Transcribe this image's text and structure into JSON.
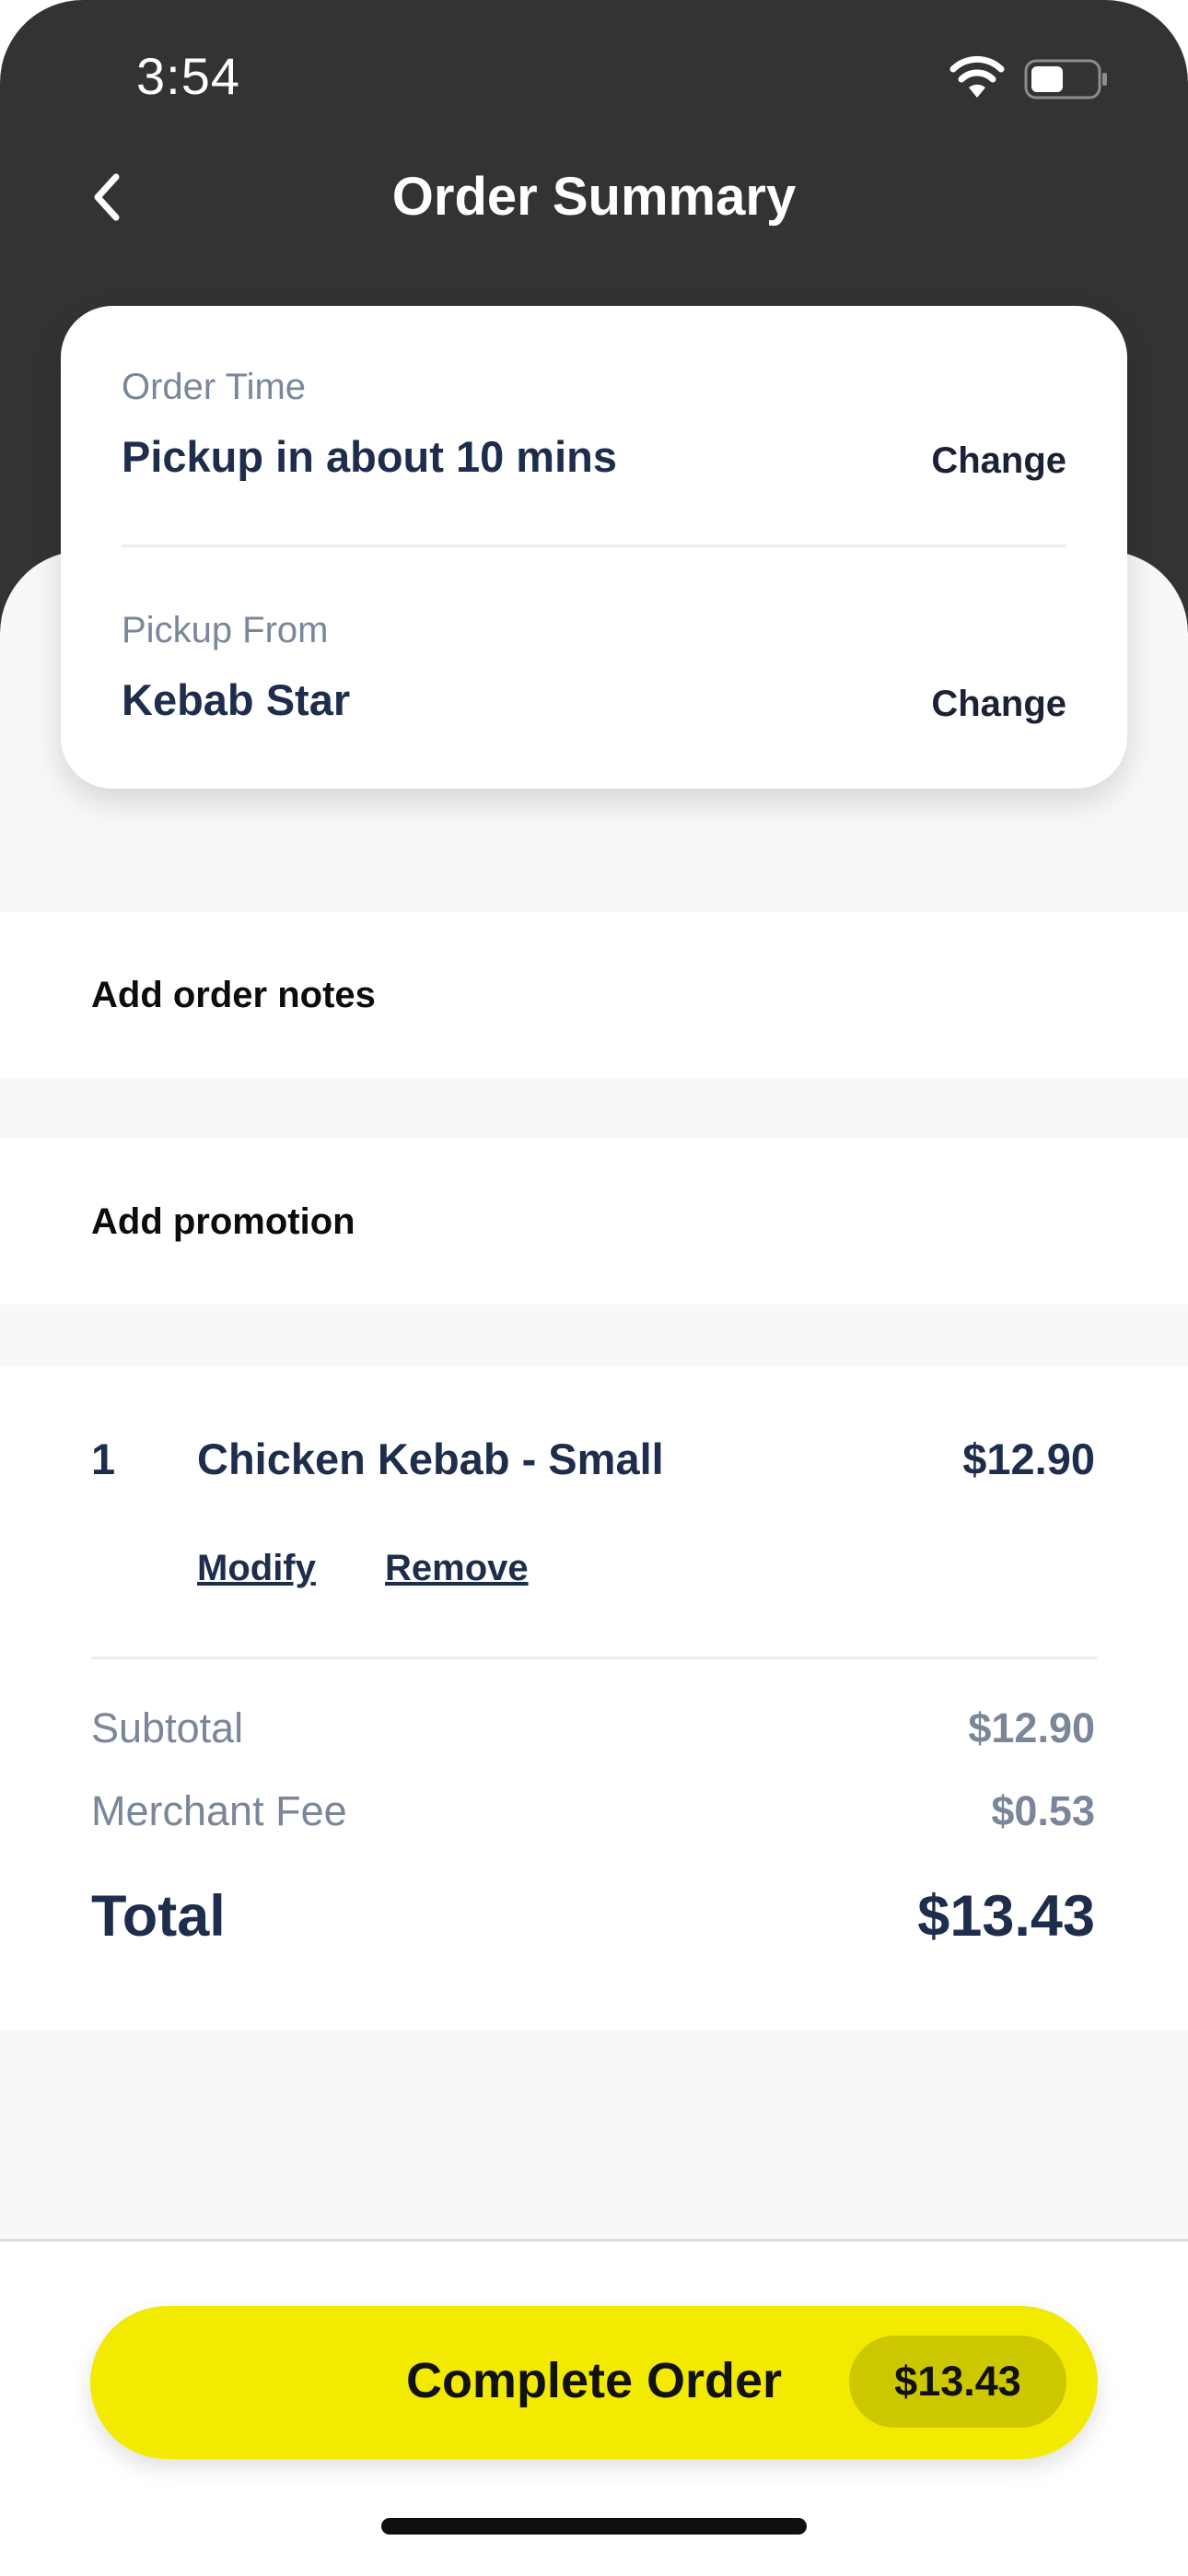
{
  "status_bar": {
    "time": "3:54"
  },
  "header": {
    "title": "Order Summary",
    "back_icon": "chevron-left-icon"
  },
  "order_card": {
    "order_time": {
      "label": "Order Time",
      "value": "Pickup in about 10 mins",
      "change_label": "Change"
    },
    "pickup_from": {
      "label": "Pickup From",
      "value": "Kebab Star",
      "change_label": "Change"
    }
  },
  "sections": {
    "order_notes_label": "Add order notes",
    "promotion_label": "Add promotion"
  },
  "items": [
    {
      "quantity": "1",
      "name": "Chicken Kebab - Small",
      "price": "$12.90",
      "modify_label": "Modify",
      "remove_label": "Remove"
    }
  ],
  "summary": {
    "subtotal_label": "Subtotal",
    "subtotal_value": "$12.90",
    "merchant_fee_label": "Merchant Fee",
    "merchant_fee_value": "$0.53",
    "total_label": "Total",
    "total_value": "$13.43"
  },
  "checkout": {
    "button_label": "Complete Order",
    "button_total": "$13.43"
  },
  "colors": {
    "header_background": "#333333",
    "accent_yellow": "#f2ea00",
    "text_navy": "#1f2d4d",
    "muted_text": "#7a8699"
  }
}
